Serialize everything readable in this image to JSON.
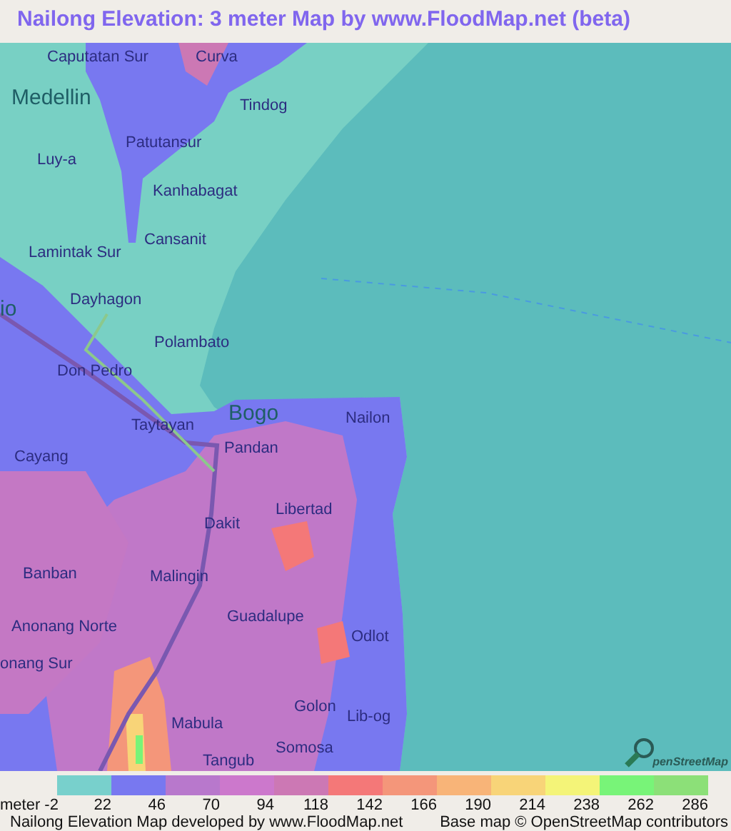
{
  "title": "Nailong Elevation: 3 meter Map by www.FloodMap.net (beta)",
  "map": {
    "labels": [
      {
        "text": "Caputatan Sur",
        "kind": "village"
      },
      {
        "text": "Curva",
        "kind": "village"
      },
      {
        "text": "Medellin",
        "kind": "town"
      },
      {
        "text": "Tindog",
        "kind": "village"
      },
      {
        "text": "Patutansur",
        "kind": "village"
      },
      {
        "text": "Luy-a",
        "kind": "village"
      },
      {
        "text": "Kanhabagat",
        "kind": "village"
      },
      {
        "text": "Cansanit",
        "kind": "village"
      },
      {
        "text": "Lamintak Sur",
        "kind": "village"
      },
      {
        "text": "io",
        "kind": "town"
      },
      {
        "text": "Dayhagon",
        "kind": "village"
      },
      {
        "text": "Polambato",
        "kind": "village"
      },
      {
        "text": "Don Pedro",
        "kind": "village"
      },
      {
        "text": "Taytayan",
        "kind": "village"
      },
      {
        "text": "Bogo",
        "kind": "town"
      },
      {
        "text": "Nailon",
        "kind": "village"
      },
      {
        "text": "Pandan",
        "kind": "village"
      },
      {
        "text": "Cayang",
        "kind": "village"
      },
      {
        "text": "Libertad",
        "kind": "village"
      },
      {
        "text": "Dakit",
        "kind": "village"
      },
      {
        "text": "Banban",
        "kind": "village"
      },
      {
        "text": "Malingin",
        "kind": "village"
      },
      {
        "text": "Guadalupe",
        "kind": "village"
      },
      {
        "text": "Anonang Norte",
        "kind": "village"
      },
      {
        "text": "Odlot",
        "kind": "village"
      },
      {
        "text": "onang Sur",
        "kind": "village"
      },
      {
        "text": "Golon",
        "kind": "village"
      },
      {
        "text": "Lib-og",
        "kind": "village"
      },
      {
        "text": "Mabula",
        "kind": "village"
      },
      {
        "text": "Somosa",
        "kind": "village"
      },
      {
        "text": "Tangub",
        "kind": "village"
      }
    ],
    "attribution_logo": "penStreetMap"
  },
  "legend": {
    "swatches": [
      {
        "color": "#78d0cc"
      },
      {
        "color": "#7878f0"
      },
      {
        "color": "#b878cc"
      },
      {
        "color": "#cc78cc"
      },
      {
        "color": "#cc78b4"
      },
      {
        "color": "#f47878"
      },
      {
        "color": "#f4967a"
      },
      {
        "color": "#f8b478"
      },
      {
        "color": "#f8d478"
      },
      {
        "color": "#f4f478"
      },
      {
        "color": "#78f478"
      },
      {
        "color": "#8ce078"
      }
    ],
    "ticks": [
      "meter -2",
      "22",
      "46",
      "70",
      "94",
      "118",
      "142",
      "166",
      "190",
      "214",
      "238",
      "262",
      "286"
    ]
  },
  "footer": {
    "credit": "Nailong Elevation Map developed by www.FloodMap.net",
    "attribution": "Base map © OpenStreetMap contributors"
  }
}
